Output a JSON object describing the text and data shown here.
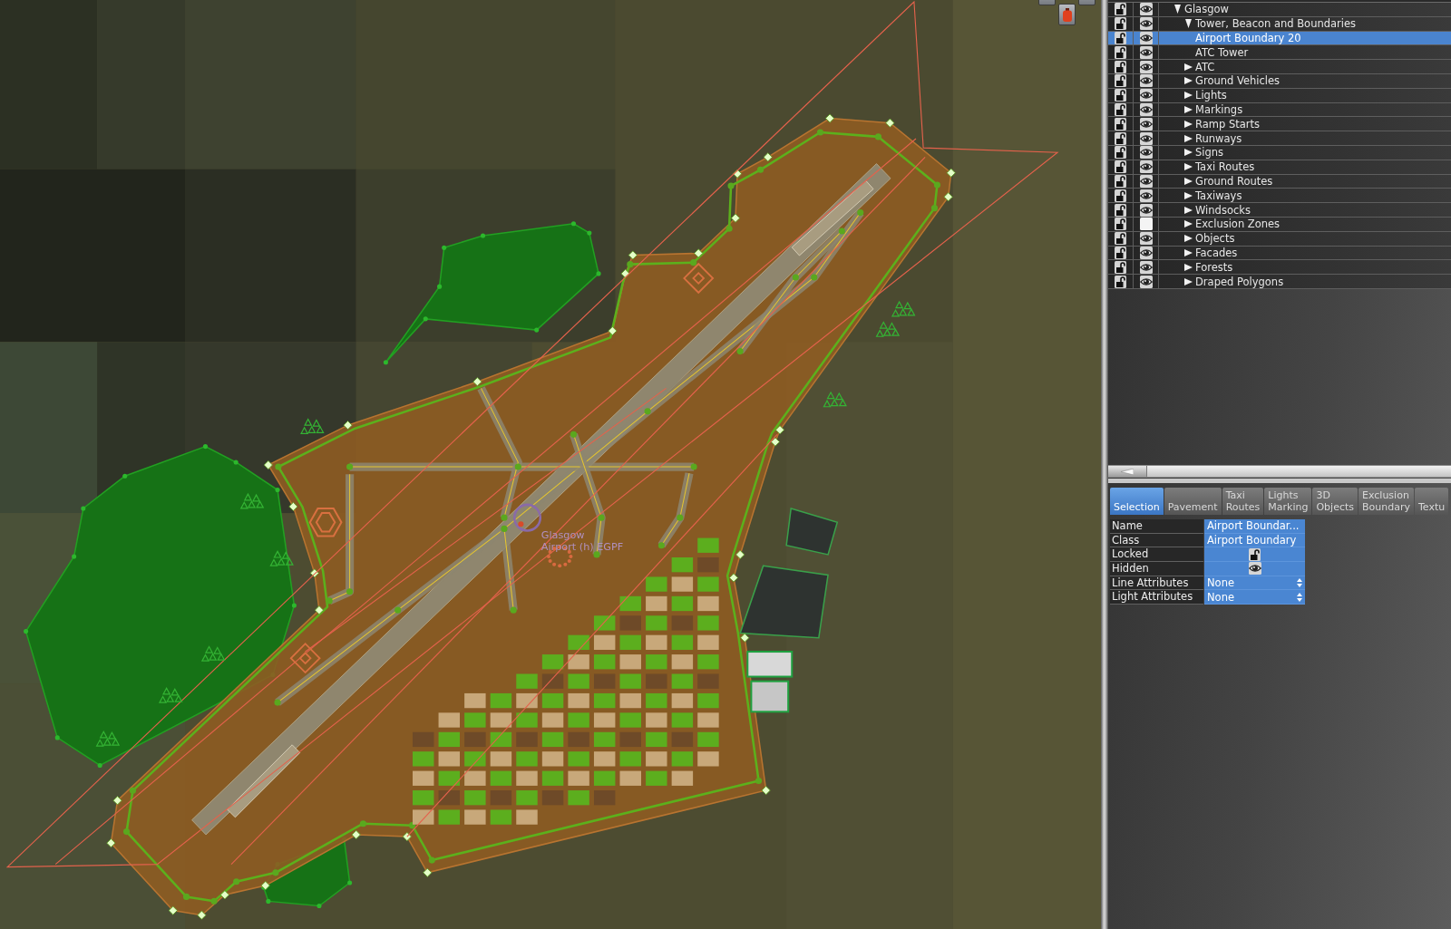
{
  "map": {
    "airport_label": [
      "Glasgow",
      "Airport (h) EGPF"
    ]
  },
  "layers": {
    "items": [
      {
        "label": "Glasgow",
        "locked": false,
        "hidden": false,
        "selected": false,
        "expanded": true,
        "children": [
          {
            "label": "Tower, Beacon and Boundaries",
            "locked": false,
            "hidden": false,
            "selected": false,
            "expanded": true,
            "children": [
              {
                "label": "Airport Boundary 20",
                "locked": false,
                "hidden": false,
                "selected": true
              },
              {
                "label": "ATC Tower",
                "locked": false,
                "hidden": false,
                "selected": false
              }
            ]
          },
          {
            "label": "ATC",
            "locked": false,
            "hidden": false,
            "selected": false,
            "expanded": false
          },
          {
            "label": "Ground Vehicles",
            "locked": false,
            "hidden": false,
            "selected": false,
            "expanded": false
          },
          {
            "label": "Lights",
            "locked": false,
            "hidden": false,
            "selected": false,
            "expanded": false
          },
          {
            "label": "Markings",
            "locked": false,
            "hidden": false,
            "selected": false,
            "expanded": false
          },
          {
            "label": "Ramp Starts",
            "locked": false,
            "hidden": false,
            "selected": false,
            "expanded": false
          },
          {
            "label": "Runways",
            "locked": false,
            "hidden": false,
            "selected": false,
            "expanded": false
          },
          {
            "label": "Signs",
            "locked": false,
            "hidden": false,
            "selected": false,
            "expanded": false
          },
          {
            "label": "Taxi Routes",
            "locked": false,
            "hidden": false,
            "selected": false,
            "expanded": false
          },
          {
            "label": "Ground Routes",
            "locked": false,
            "hidden": false,
            "selected": false,
            "expanded": false
          },
          {
            "label": "Taxiways",
            "locked": false,
            "hidden": false,
            "selected": false,
            "expanded": false
          },
          {
            "label": "Windsocks",
            "locked": false,
            "hidden": false,
            "selected": false,
            "expanded": false
          },
          {
            "label": "Exclusion Zones",
            "locked": false,
            "hidden": true,
            "selected": false,
            "expanded": false
          },
          {
            "label": "Objects",
            "locked": false,
            "hidden": false,
            "selected": false,
            "expanded": false
          },
          {
            "label": "Facades",
            "locked": false,
            "hidden": false,
            "selected": false,
            "expanded": false
          },
          {
            "label": "Forests",
            "locked": false,
            "hidden": false,
            "selected": false,
            "expanded": false
          },
          {
            "label": "Draped Polygons",
            "locked": false,
            "hidden": false,
            "selected": false,
            "expanded": false
          }
        ]
      }
    ]
  },
  "tabs": [
    {
      "label": "Selection",
      "selected": true
    },
    {
      "label": "Pavement",
      "selected": false
    },
    {
      "label": "Taxi Routes",
      "selected": false
    },
    {
      "label": "Lights Marking",
      "selected": false
    },
    {
      "label": "3D Objects",
      "selected": false
    },
    {
      "label": "Exclusion Boundary",
      "selected": false
    },
    {
      "label": "Textu",
      "selected": false
    }
  ],
  "properties": [
    {
      "label": "Name",
      "kind": "text",
      "value": "Airport Boundar..."
    },
    {
      "label": "Class",
      "kind": "text",
      "value": "Airport Boundary"
    },
    {
      "label": "Locked",
      "kind": "lock",
      "locked": false
    },
    {
      "label": "Hidden",
      "kind": "eye",
      "hidden": false
    },
    {
      "label": "Line Attributes",
      "kind": "menu",
      "value": "None"
    },
    {
      "label": "Light Attributes",
      "kind": "menu",
      "value": "None"
    }
  ]
}
